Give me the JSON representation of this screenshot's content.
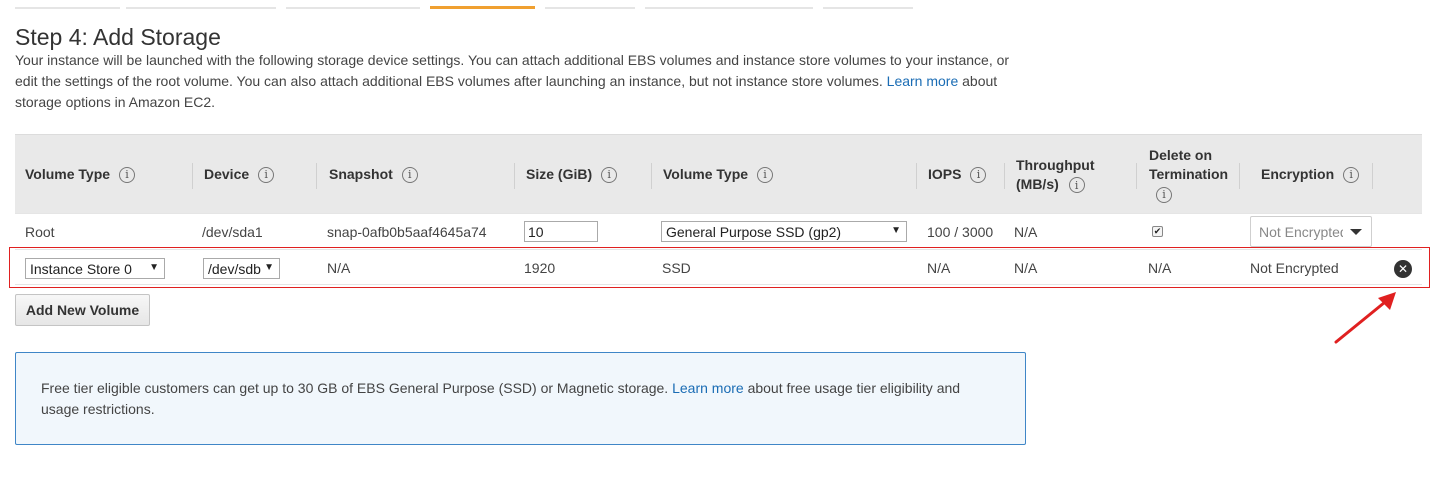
{
  "tabs": [
    {
      "label": ""
    },
    {
      "label": ""
    },
    {
      "label": ""
    },
    {
      "label": ""
    },
    {
      "label": ""
    },
    {
      "label": ""
    },
    {
      "label": ""
    }
  ],
  "page": {
    "title": "Step 4: Add Storage",
    "intro_part1": "Your instance will be launched with the following storage device settings. You can attach additional EBS volumes and instance store volumes to your instance, or edit the settings of the root volume. You can also attach additional EBS volumes after launching an instance, but not instance store volumes.",
    "intro_link": "Learn more",
    "intro_part2": "about storage options in Amazon EC2."
  },
  "table": {
    "headers": {
      "volume_type": "Volume Type",
      "device": "Device",
      "snapshot": "Snapshot",
      "size": "Size (GiB)",
      "volume_type2": "Volume Type",
      "iops": "IOPS",
      "throughput_line1": "Throughput",
      "throughput_line2": "(MB/s)",
      "delete_line1": "Delete on",
      "delete_line2": "Termination",
      "encryption": "Encryption"
    },
    "info_glyph": "i",
    "rows": [
      {
        "volume_type": "Root",
        "device": "/dev/sda1",
        "snapshot": "snap-0afb0b5aaf4645a74",
        "size": "10",
        "volume_type2": "General Purpose SSD (gp2)",
        "iops": "100 / 3000",
        "throughput": "N/A",
        "delete_on_termination": true,
        "check_glyph": "✔",
        "encryption": "Not Encrypted"
      },
      {
        "volume_type": "Instance Store 0",
        "device": "/dev/sdb",
        "snapshot": "N/A",
        "size": "1920",
        "volume_type2": "SSD",
        "iops": "N/A",
        "throughput": "N/A",
        "delete_on_termination": "N/A",
        "encryption": "Not Encrypted",
        "remove_glyph": "✕"
      }
    ],
    "dropdown_arrow": "▼"
  },
  "actions": {
    "add_new_volume": "Add New Volume"
  },
  "notice": {
    "text_part1": "Free tier eligible customers can get up to 30 GB of EBS General Purpose (SSD) or Magnetic storage.",
    "link": "Learn more",
    "text_part2": "about free usage tier eligibility and usage restrictions."
  },
  "colors": {
    "active_tab": "#f0a030",
    "link": "#1a6cb4",
    "highlight": "#e02020",
    "notice_border": "#3f86c7"
  }
}
